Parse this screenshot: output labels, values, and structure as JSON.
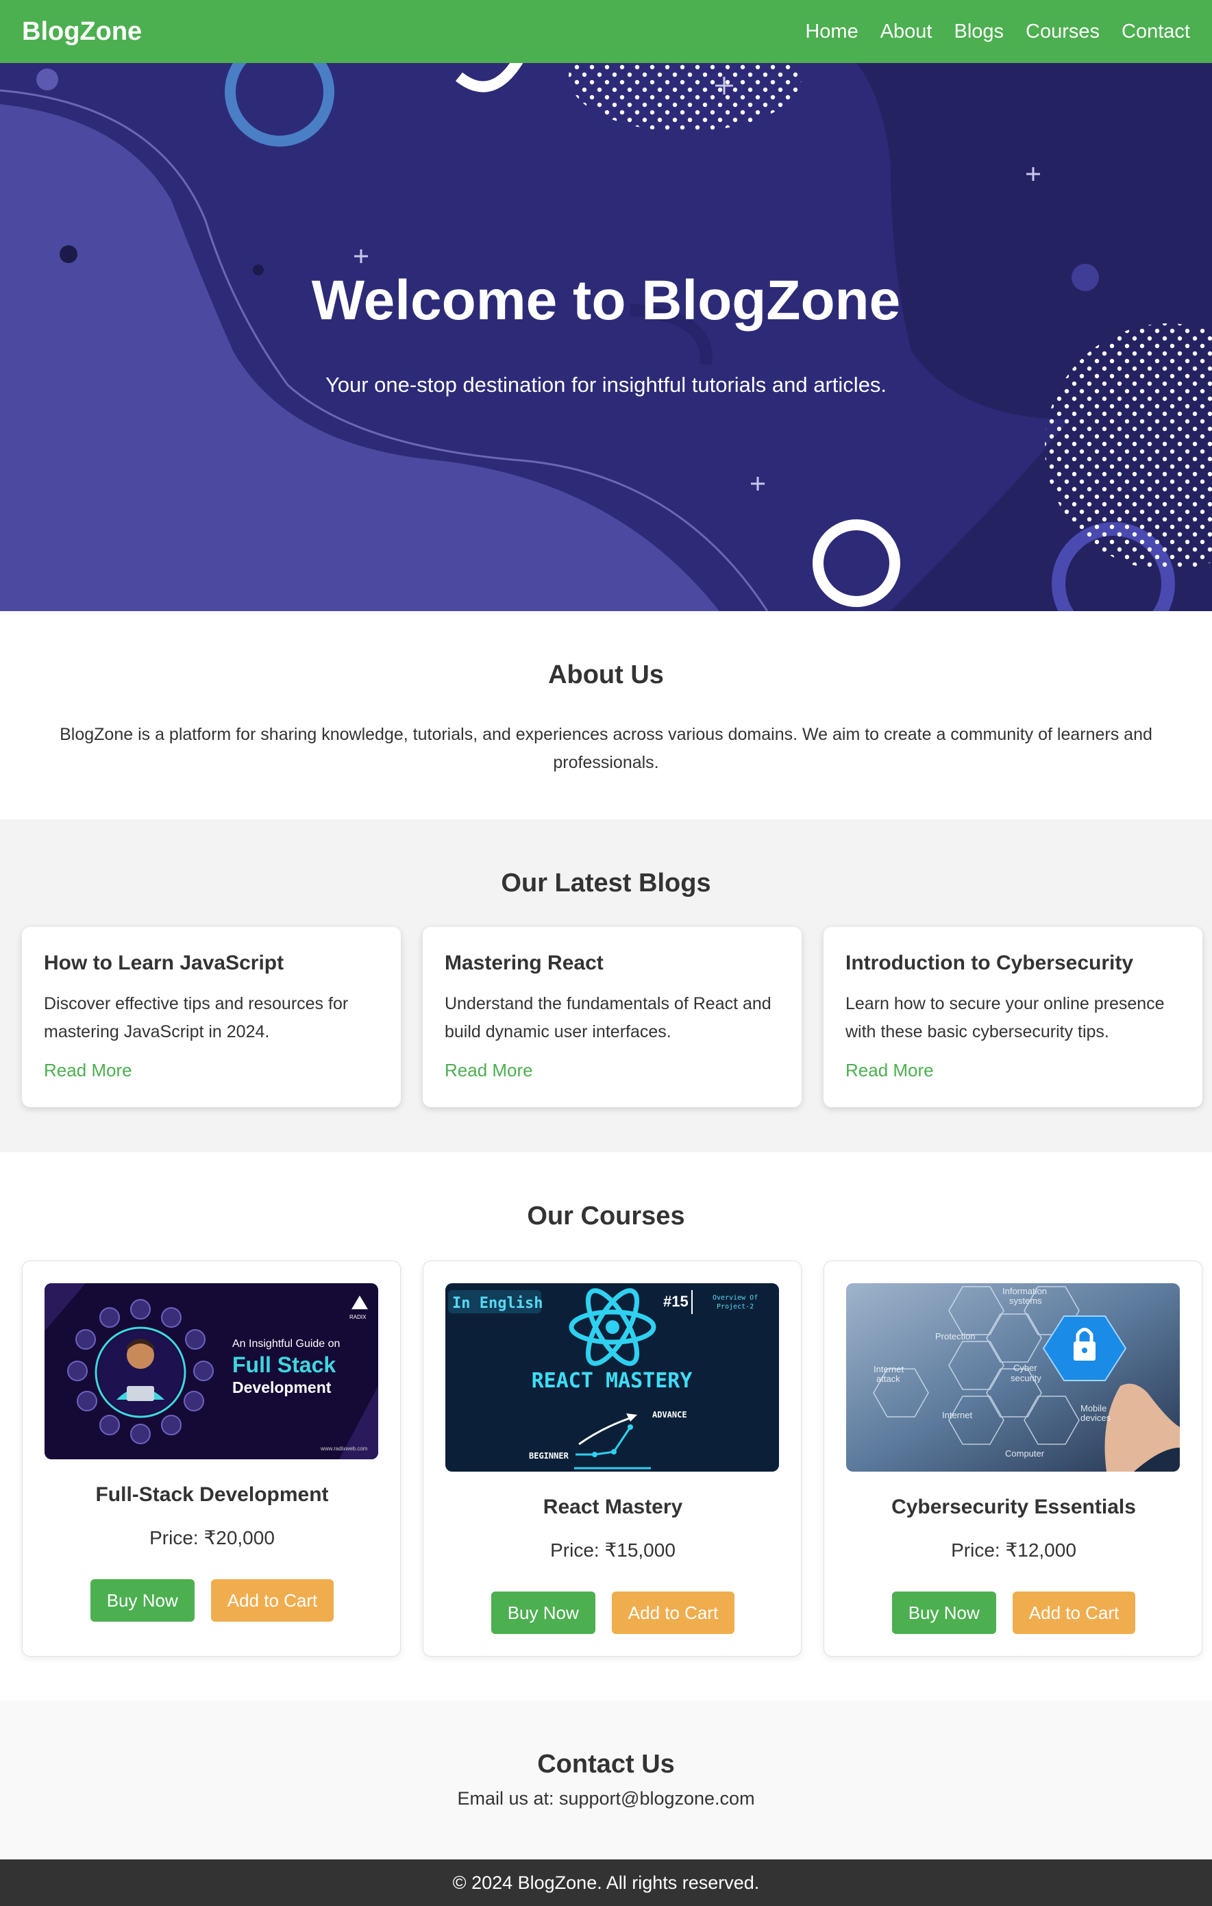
{
  "nav": {
    "brand": "BlogZone",
    "links": [
      "Home",
      "About",
      "Blogs",
      "Courses",
      "Contact"
    ]
  },
  "hero": {
    "title": "Welcome to BlogZone",
    "subtitle": "Your one-stop destination for insightful tutorials and articles."
  },
  "about": {
    "title": "About Us",
    "text": "BlogZone is a platform for sharing knowledge, tutorials, and experiences across various domains. We aim to create a community of learners and professionals."
  },
  "blogs": {
    "title": "Our Latest Blogs",
    "items": [
      {
        "title": "How to Learn JavaScript",
        "desc": "Discover effective tips and resources for mastering JavaScript in 2024.",
        "link": "Read More"
      },
      {
        "title": "Mastering React",
        "desc": "Understand the fundamentals of React and build dynamic user interfaces.",
        "link": "Read More"
      },
      {
        "title": "Introduction to Cybersecurity",
        "desc": "Learn how to secure your online presence with these basic cybersecurity tips.",
        "link": "Read More"
      }
    ]
  },
  "courses": {
    "title": "Our Courses",
    "buy_label": "Buy Now",
    "cart_label": "Add to Cart",
    "items": [
      {
        "title": "Full-Stack Development",
        "price": "Price: ₹20,000",
        "image": {
          "line1": "An Insightful Guide on",
          "line2": "Full Stack",
          "line3": "Development",
          "brand": "RADIX",
          "url": "www.radixweb.com"
        }
      },
      {
        "title": "React Mastery",
        "price": "Price: ₹15,000",
        "image": {
          "tag": "In English",
          "episode": "#15",
          "overview_1": "Overview Of",
          "overview_2": "Project-2",
          "heading": "REACT MASTERY",
          "advance": "ADVANCE",
          "beginner": "BEGINNER"
        }
      },
      {
        "title": "Cybersecurity Essentials",
        "price": "Price: ₹12,000",
        "image": {
          "l1": "Information",
          "l2": "systems",
          "l3": "Protection",
          "l4": "Internet",
          "l5": "attack",
          "l6": "Cyber",
          "l7": "security",
          "l8": "Internet",
          "l9": "Mobile",
          "l10": "devices",
          "l11": "Computer"
        }
      }
    ]
  },
  "contact": {
    "title": "Contact Us",
    "text": "Email us at: support@blogzone.com"
  },
  "footer": {
    "text": "© 2024 BlogZone. All rights reserved."
  },
  "colors": {
    "primary": "#4caf50",
    "accent": "#f0ad4e",
    "hero_bg": "#2d2b78",
    "footer_bg": "#333333"
  }
}
